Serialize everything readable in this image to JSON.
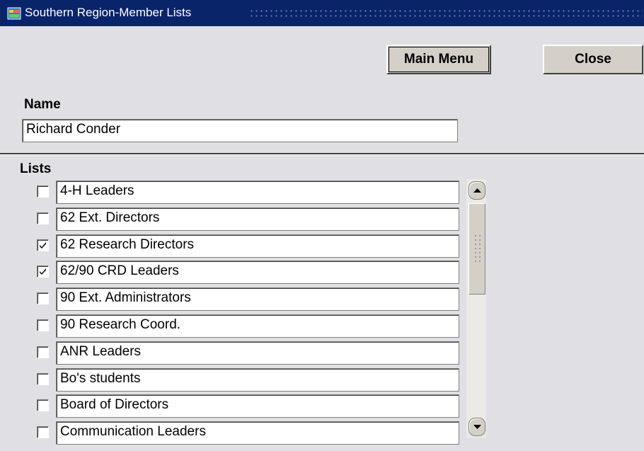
{
  "window": {
    "title": "Southern Region-Member Lists"
  },
  "toolbar": {
    "main_menu_label": "Main Menu",
    "close_label": "Close"
  },
  "name_section": {
    "label": "Name",
    "value": "Richard Conder"
  },
  "lists_section": {
    "label": "Lists",
    "items": [
      {
        "label": "4-H Leaders",
        "checked": false
      },
      {
        "label": "62 Ext. Directors",
        "checked": false
      },
      {
        "label": "62 Research Directors",
        "checked": true
      },
      {
        "label": "62/90 CRD Leaders",
        "checked": true
      },
      {
        "label": "90 Ext.  Administrators",
        "checked": false
      },
      {
        "label": "90 Research Coord.",
        "checked": false
      },
      {
        "label": "ANR Leaders",
        "checked": false
      },
      {
        "label": "Bo's students",
        "checked": false
      },
      {
        "label": "Board of Directors",
        "checked": false
      },
      {
        "label": "Communication Leaders",
        "checked": false
      }
    ]
  },
  "colors": {
    "titlebar": "#0a246a",
    "window_bg": "#e0dfe3",
    "button_face": "#d4d0c8"
  }
}
